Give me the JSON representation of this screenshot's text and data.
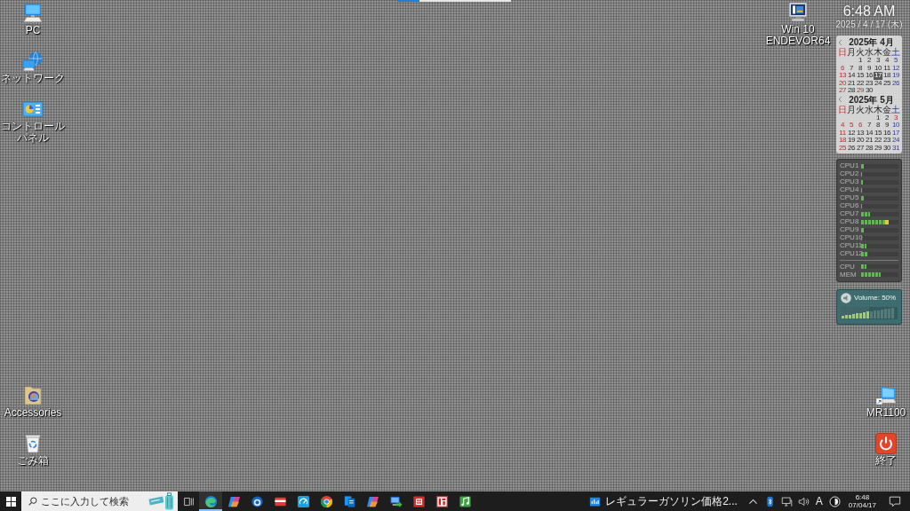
{
  "desktop": {
    "left_top": [
      {
        "label": "PC",
        "kind": "pc"
      },
      {
        "label": "ネットワーク",
        "kind": "network"
      },
      {
        "label": "コントロールパネル",
        "kind": "control_panel"
      }
    ],
    "left_bottom": [
      {
        "label": "Accessories",
        "kind": "picture_folder"
      },
      {
        "label": "ごみ箱",
        "kind": "recycle_bin"
      }
    ],
    "top_right": [
      {
        "label": "Win 10 ENDEVOR64",
        "kind": "monitor_app"
      }
    ],
    "bottom_right": [
      {
        "label": "MR1100",
        "kind": "remote_pc"
      },
      {
        "label": "終了",
        "kind": "power"
      }
    ]
  },
  "clock_widget": {
    "time": "6:48 AM",
    "date": "2025 / 4 / 17 (木)"
  },
  "calendar": {
    "months": [
      {
        "title": "2025年 4月",
        "weekdays": [
          {
            "label": "日",
            "kind": "sunday"
          },
          {
            "label": "月",
            "kind": "weekday"
          },
          {
            "label": "火",
            "kind": "weekday"
          },
          {
            "label": "水",
            "kind": "weekday"
          },
          {
            "label": "木",
            "kind": "weekday"
          },
          {
            "label": "金",
            "kind": "weekday"
          },
          {
            "label": "土",
            "kind": "saturday"
          }
        ],
        "weeks": [
          {
            "days": [
              {
                "day": "1",
                "kind": "weekday",
                "selected": false
              },
              {
                "day": "2",
                "kind": "weekday",
                "selected": false
              },
              {
                "day": "3",
                "kind": "weekday",
                "selected": false
              },
              {
                "day": "4",
                "kind": "weekday",
                "selected": false
              },
              {
                "day": "5",
                "kind": "saturday",
                "selected": false
              }
            ]
          },
          {
            "days": [
              {
                "day": "6",
                "kind": "sunday",
                "selected": false
              },
              {
                "day": "7",
                "kind": "weekday",
                "selected": false
              },
              {
                "day": "8",
                "kind": "weekday",
                "selected": false
              },
              {
                "day": "9",
                "kind": "weekday",
                "selected": false
              },
              {
                "day": "10",
                "kind": "weekday",
                "selected": false
              },
              {
                "day": "11",
                "kind": "weekday",
                "selected": false
              },
              {
                "day": "12",
                "kind": "saturday",
                "selected": false
              }
            ]
          },
          {
            "days": [
              {
                "day": "13",
                "kind": "sunday",
                "selected": false
              },
              {
                "day": "14",
                "kind": "weekday",
                "selected": false
              },
              {
                "day": "15",
                "kind": "weekday",
                "selected": false
              },
              {
                "day": "16",
                "kind": "weekday",
                "selected": false
              },
              {
                "day": "17",
                "kind": "weekday",
                "selected": true
              },
              {
                "day": "18",
                "kind": "weekday",
                "selected": false
              },
              {
                "day": "19",
                "kind": "saturday",
                "selected": false
              }
            ]
          },
          {
            "days": [
              {
                "day": "20",
                "kind": "sunday",
                "selected": false
              },
              {
                "day": "21",
                "kind": "weekday",
                "selected": false
              },
              {
                "day": "22",
                "kind": "weekday",
                "selected": false
              },
              {
                "day": "23",
                "kind": "weekday",
                "selected": false
              },
              {
                "day": "24",
                "kind": "weekday",
                "selected": false
              },
              {
                "day": "25",
                "kind": "weekday",
                "selected": false
              },
              {
                "day": "26",
                "kind": "saturday",
                "selected": false
              }
            ]
          },
          {
            "days": [
              {
                "day": "27",
                "kind": "sunday",
                "selected": false
              },
              {
                "day": "28",
                "kind": "weekday",
                "selected": false
              },
              {
                "day": "29",
                "kind": "holiday",
                "selected": false
              },
              {
                "day": "30",
                "kind": "weekday",
                "selected": false
              }
            ]
          }
        ]
      },
      {
        "title": "2025年 5月",
        "weekdays": [
          {
            "label": "日",
            "kind": "sunday"
          },
          {
            "label": "月",
            "kind": "weekday"
          },
          {
            "label": "火",
            "kind": "weekday"
          },
          {
            "label": "水",
            "kind": "weekday"
          },
          {
            "label": "木",
            "kind": "weekday"
          },
          {
            "label": "金",
            "kind": "weekday"
          },
          {
            "label": "土",
            "kind": "saturday"
          }
        ],
        "weeks": [
          {
            "days": [
              {
                "day": "1",
                "kind": "weekday",
                "selected": false
              },
              {
                "day": "2",
                "kind": "weekday",
                "selected": false
              },
              {
                "day": "3",
                "kind": "holiday",
                "selected": false
              }
            ]
          },
          {
            "days": [
              {
                "day": "4",
                "kind": "sunday",
                "selected": false
              },
              {
                "day": "5",
                "kind": "holiday",
                "selected": false
              },
              {
                "day": "6",
                "kind": "holiday",
                "selected": false
              },
              {
                "day": "7",
                "kind": "weekday",
                "selected": false
              },
              {
                "day": "8",
                "kind": "weekday",
                "selected": false
              },
              {
                "day": "9",
                "kind": "weekday",
                "selected": false
              },
              {
                "day": "10",
                "kind": "saturday",
                "selected": false
              }
            ]
          },
          {
            "days": [
              {
                "day": "11",
                "kind": "sunday",
                "selected": false
              },
              {
                "day": "12",
                "kind": "weekday",
                "selected": false
              },
              {
                "day": "13",
                "kind": "weekday",
                "selected": false
              },
              {
                "day": "14",
                "kind": "weekday",
                "selected": false
              },
              {
                "day": "15",
                "kind": "weekday",
                "selected": false
              },
              {
                "day": "16",
                "kind": "weekday",
                "selected": false
              },
              {
                "day": "17",
                "kind": "saturday",
                "selected": false
              }
            ]
          },
          {
            "days": [
              {
                "day": "18",
                "kind": "sunday",
                "selected": false
              },
              {
                "day": "19",
                "kind": "weekday",
                "selected": false
              },
              {
                "day": "20",
                "kind": "weekday",
                "selected": false
              },
              {
                "day": "21",
                "kind": "weekday",
                "selected": false
              },
              {
                "day": "22",
                "kind": "weekday",
                "selected": false
              },
              {
                "day": "23",
                "kind": "weekday",
                "selected": false
              },
              {
                "day": "24",
                "kind": "saturday",
                "selected": false
              }
            ]
          },
          {
            "days": [
              {
                "day": "25",
                "kind": "sunday",
                "selected": false
              },
              {
                "day": "26",
                "kind": "weekday",
                "selected": false
              },
              {
                "day": "27",
                "kind": "weekday",
                "selected": false
              },
              {
                "day": "28",
                "kind": "weekday",
                "selected": false
              },
              {
                "day": "29",
                "kind": "weekday",
                "selected": false
              },
              {
                "day": "30",
                "kind": "weekday",
                "selected": false
              },
              {
                "day": "31",
                "kind": "saturday",
                "selected": false
              }
            ]
          }
        ]
      }
    ]
  },
  "cpu_meter": {
    "cores": [
      {
        "label": "CPU1",
        "level": 0.08
      },
      {
        "label": "CPU2",
        "level": 0
      },
      {
        "label": "CPU3",
        "level": 0.04
      },
      {
        "label": "CPU4",
        "level": 0
      },
      {
        "label": "CPU5",
        "level": 0.08
      },
      {
        "label": "CPU6",
        "level": 0
      },
      {
        "label": "CPU7",
        "level": 0.24
      },
      {
        "label": "CPU8",
        "level": 0.73
      },
      {
        "label": "CPU9",
        "level": 0.08
      },
      {
        "label": "CPU10",
        "level": 0
      },
      {
        "label": "CPU11",
        "level": 0.14
      },
      {
        "label": "CPU12",
        "level": 0.19
      }
    ],
    "totals": [
      {
        "label": "CPU",
        "level": 0.14
      },
      {
        "label": "MEM",
        "level": 0.52
      }
    ]
  },
  "volume_widget": {
    "label": "Volume: 50%",
    "level": 0.5
  },
  "taskbar": {
    "search": {
      "placeholder": "ここに入力して検索"
    },
    "apps": [
      {
        "kind": "swirl",
        "running": true
      },
      {
        "kind": "ribbon",
        "running": false
      },
      {
        "kind": "orb",
        "running": false
      },
      {
        "kind": "card",
        "running": false
      },
      {
        "kind": "gauge",
        "running": false
      },
      {
        "kind": "segmented_circle",
        "running": false
      },
      {
        "kind": "documents",
        "running": false
      },
      {
        "kind": "ribbon",
        "running": false
      },
      {
        "kind": "computer_arrow",
        "running": false
      },
      {
        "kind": "square_emblem",
        "running": false
      },
      {
        "kind": "badge_logo",
        "running": false
      },
      {
        "kind": "music",
        "running": false
      }
    ],
    "window_button": {
      "label": "レギュラーガソリン価格2..."
    },
    "tray": [
      {
        "kind": "caret"
      },
      {
        "kind": "bluetooth"
      },
      {
        "kind": "network"
      },
      {
        "kind": "volume"
      },
      {
        "kind": "ime",
        "label": "A"
      },
      {
        "kind": "round_badge"
      }
    ],
    "clock": {
      "time": "6:48",
      "date": "07/04/17"
    }
  }
}
